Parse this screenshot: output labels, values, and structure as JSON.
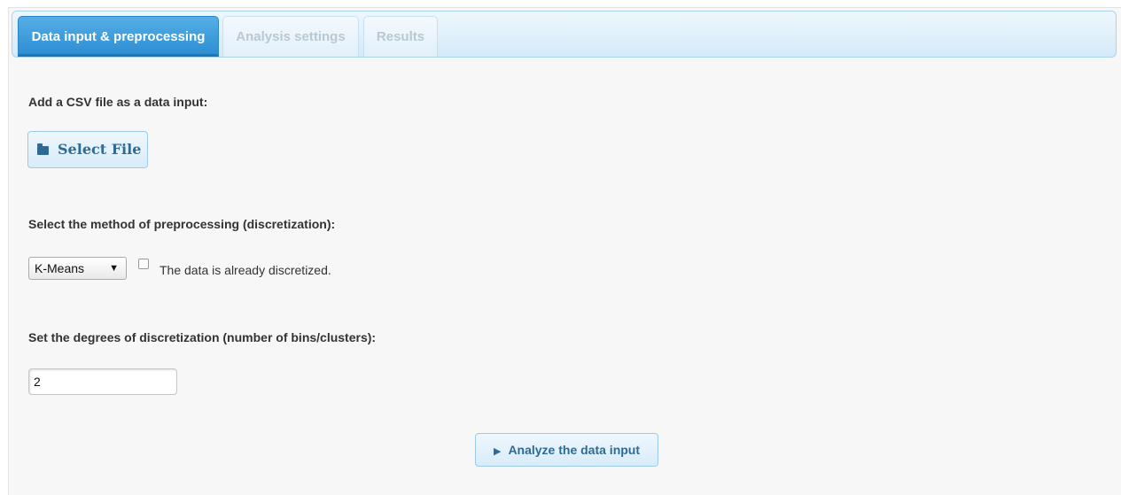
{
  "tabs": [
    {
      "label": "Data input & preprocessing",
      "active": true
    },
    {
      "label": "Analysis settings",
      "active": false
    },
    {
      "label": "Results",
      "active": false
    }
  ],
  "data_input": {
    "csv_label": "Add a CSV file as a data input:",
    "select_file_button": "Select File",
    "select_file_icon": "folder-icon"
  },
  "preprocessing": {
    "method_label": "Select the method of preprocessing (discretization):",
    "method_selected": "K-Means",
    "already_discretized_label": "The data is already discretized.",
    "already_discretized_checked": false
  },
  "discretization": {
    "degrees_label": "Set the degrees of discretization (number of bins/clusters):",
    "degrees_value": "2"
  },
  "actions": {
    "analyze_button": "Analyze the data input",
    "analyze_icon": "play-icon"
  },
  "colors": {
    "active_tab": "#3a9ad9",
    "button_text": "#2d6a94",
    "panel_bg": "#f7f7f7"
  }
}
